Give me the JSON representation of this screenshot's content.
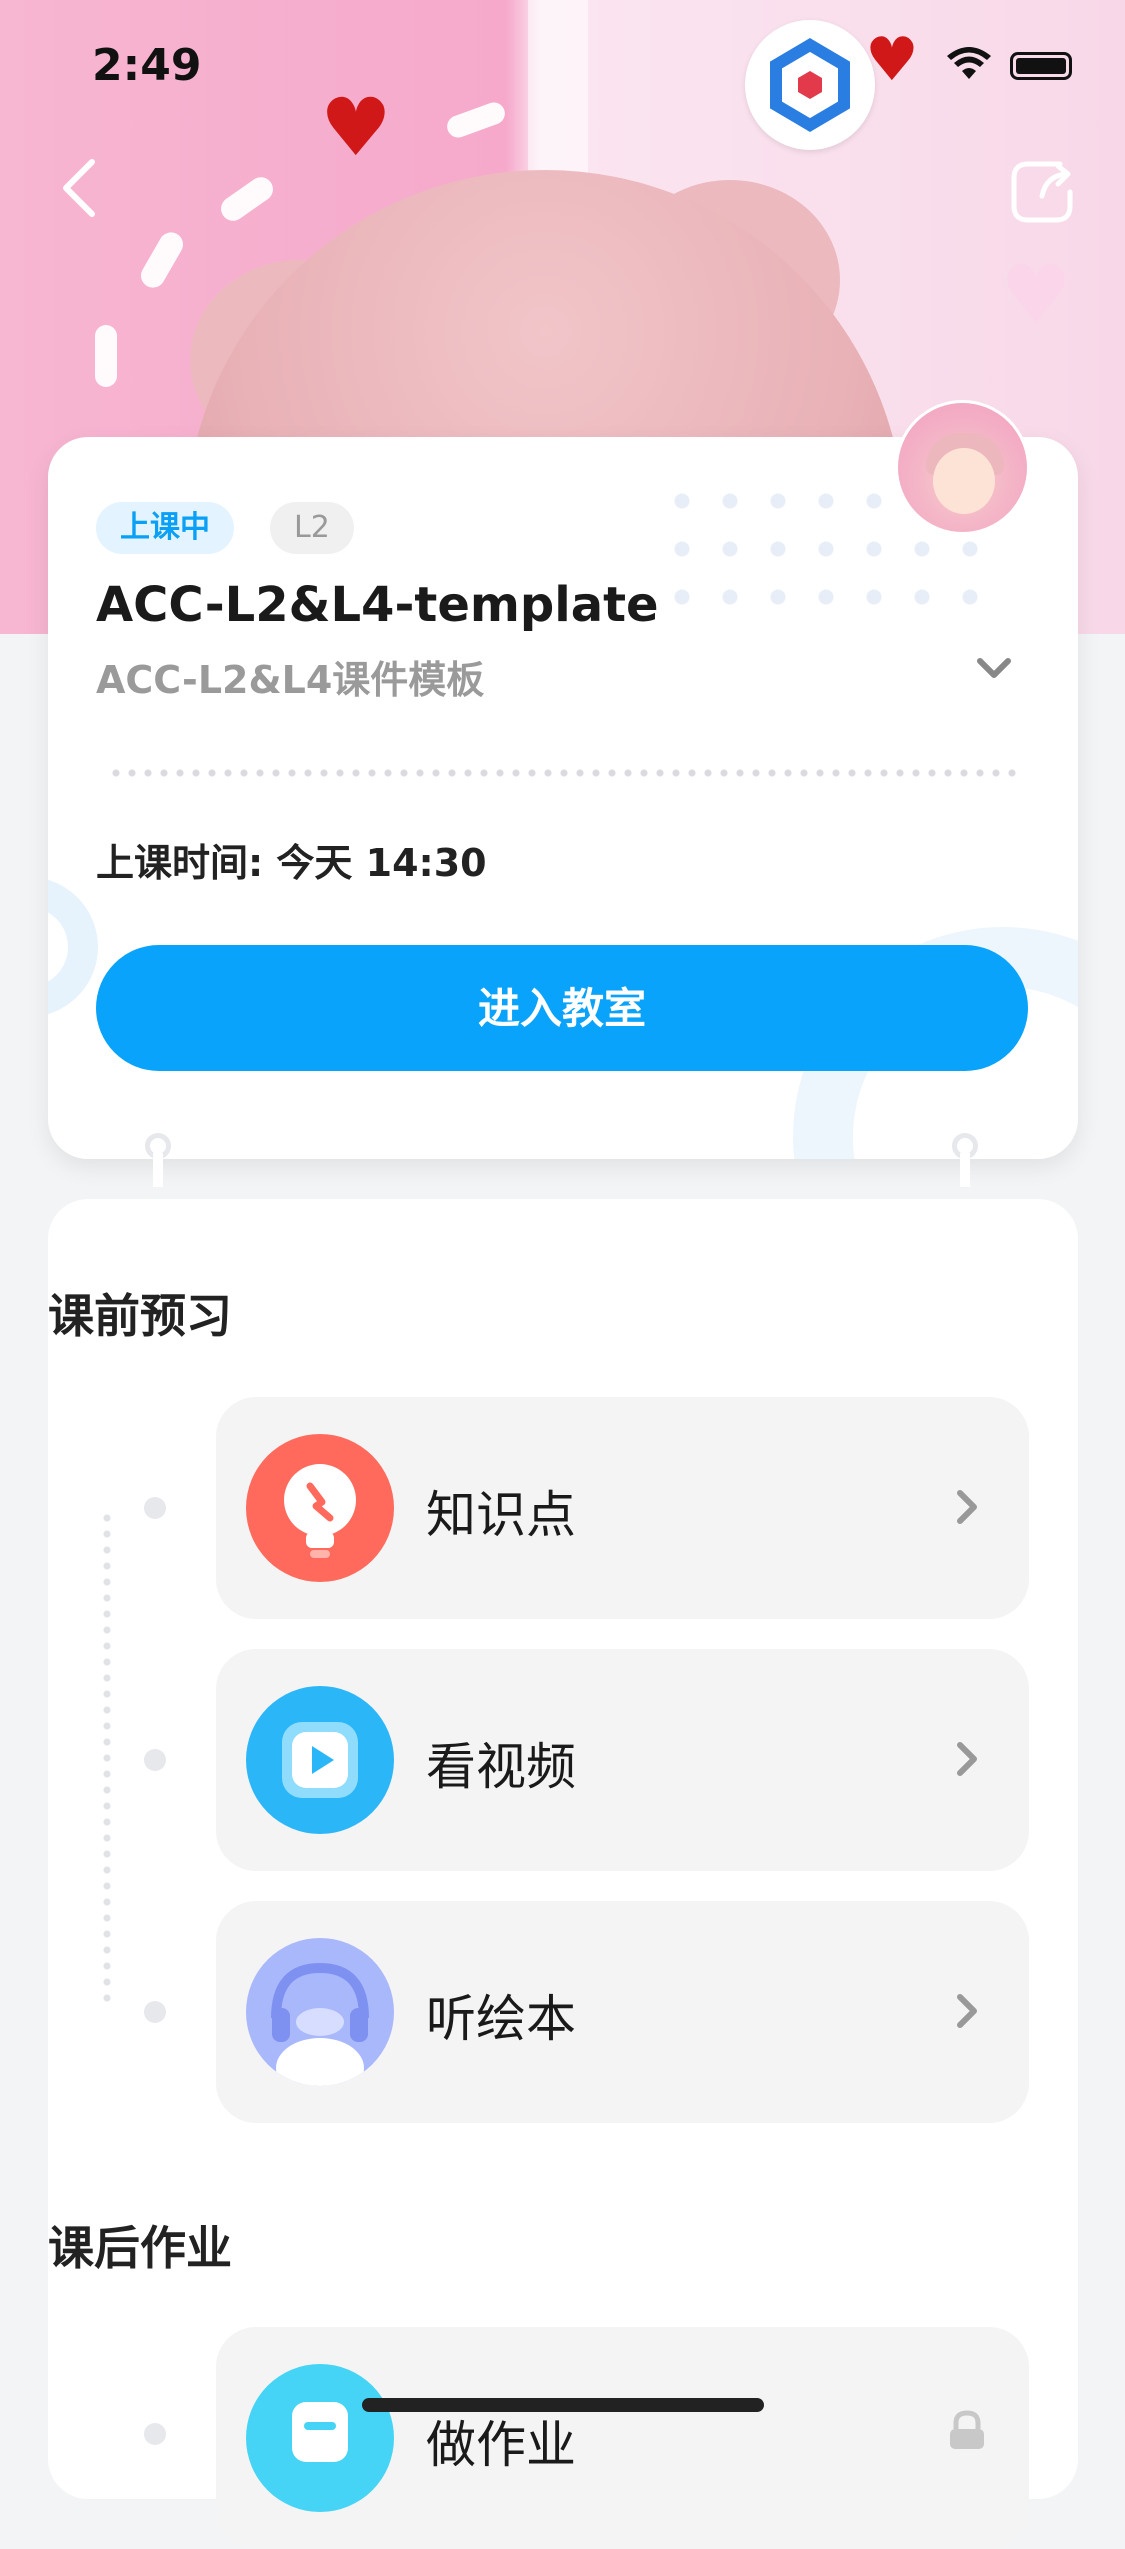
{
  "status_bar": {
    "time": "2:49"
  },
  "course": {
    "status_badge": "上课中",
    "level_badge": "L2",
    "title": "ACC-L2&L4-template",
    "subtitle": "ACC-L2&L4课件模板",
    "class_time": "上课时间: 今天 14:30",
    "enter_button": "进入教室"
  },
  "preview": {
    "section_title": "课前预习",
    "items": [
      {
        "label": "知识点",
        "icon": "lightbulb-icon",
        "color": "#ff6a5c"
      },
      {
        "label": "看视频",
        "icon": "video-play-icon",
        "color": "#2bb6f8"
      },
      {
        "label": "听绘本",
        "icon": "headphones-icon",
        "color": "#a9b8fb"
      }
    ]
  },
  "homework": {
    "section_title": "课后作业",
    "items": [
      {
        "label": "做作业",
        "icon": "homework-icon",
        "color": "#45d4f5",
        "locked": true
      }
    ]
  },
  "colors": {
    "primary": "#0aa3fb",
    "badge_bg": "#e3f3ff"
  }
}
